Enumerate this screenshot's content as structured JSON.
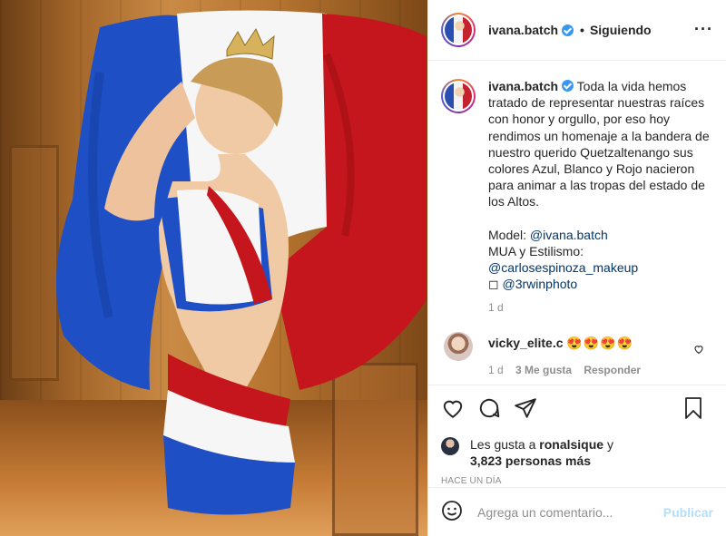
{
  "post": {
    "username": "ivana.batch",
    "follow_status": "Siguiendo",
    "dot": "•",
    "more_icon": "more-icon",
    "caption": {
      "username": "ivana.batch",
      "text": "Toda la vida hemos tratado de representar nuestras raíces con honor y orgullo, por eso hoy rendimos un homenaje a la bandera de nuestro querido Quetzaltenango sus colores Azul, Blanco y Rojo nacieron para animar a las tropas del estado de los Altos.",
      "model_label": "Model: ",
      "model_link": "@ivana.batch",
      "mua_label": "MUA y Estilismo:",
      "mua_link": "@carlosespinoza_makeup",
      "photo_prefix": "◻ ",
      "photo_link": "@3rwinphoto",
      "time": "1 d"
    },
    "comment": {
      "username": "vicky_elite.c",
      "text": "😍😍😍😍",
      "time": "1 d",
      "likes": "3 Me gusta",
      "reply": "Responder"
    },
    "likes": {
      "prefix": "Les gusta a ",
      "user": "ronalsique",
      "middle": " y",
      "count": "3,823 personas más"
    },
    "time_ago": "HACE UN DÍA",
    "add_comment": {
      "placeholder": "Agrega un comentario...",
      "post_label": "Publicar"
    }
  },
  "colors": {
    "flag_blue": "#1f4fc4",
    "flag_white": "#f6f6f6",
    "flag_red": "#c4161c",
    "link": "#00376b",
    "verified": "#3897f0",
    "post_disabled": "#b2dffc"
  }
}
